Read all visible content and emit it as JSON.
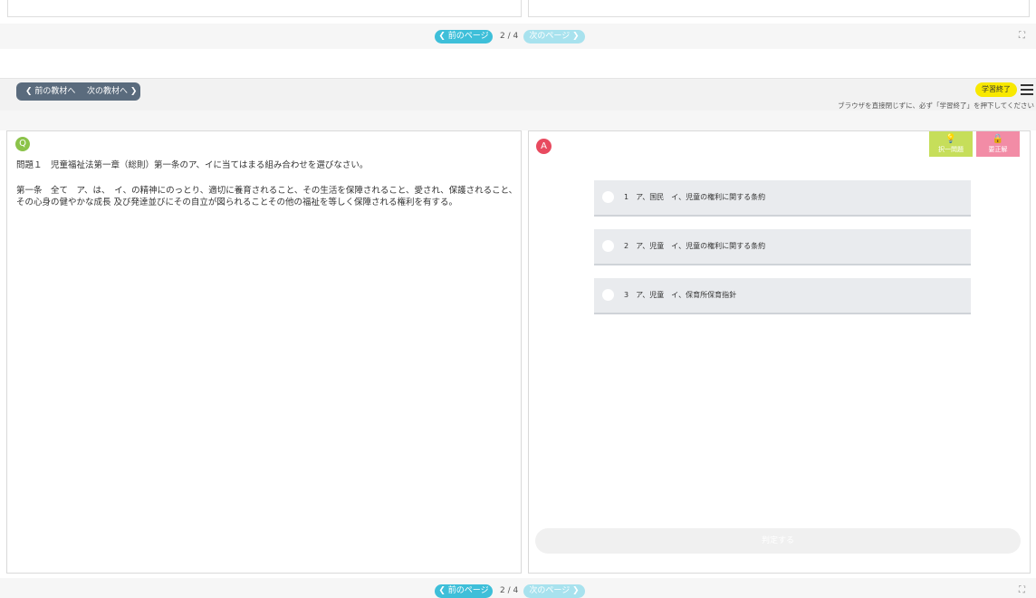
{
  "pager": {
    "prev_label": "❮ 前のページ",
    "page": "2 / 4",
    "next_label": "次のページ ❯",
    "fullscreen_icon": "fullscreen-icon"
  },
  "toolbar": {
    "prev_material": "❮ 前の教材へ",
    "next_material": "次の教材へ ❯",
    "finish_label": "学習終了",
    "notice": "ブラウザを直接閉じずに、必ず「学習終了」を押下してください"
  },
  "question": {
    "badge": "Q",
    "title": "問題１　児童福祉法第一章（総則）第一条のア、イに当てはまる組み合わせを選びなさい。",
    "body": "第一条　全て　ア、は、　イ、の精神にのっとり、適切に養育されること、その生活を保障されること、愛され、保護されること、その心身の健やかな成長 及び発達並びにその自立が図られることその他の福祉を等しく保障される権利を有する。"
  },
  "answer": {
    "badge": "A",
    "hint_label": "択一問題",
    "show_answer_label": "要正解",
    "choices": [
      {
        "label": "1　ア、国民　イ、児童の権利に関する条約"
      },
      {
        "label": "2　ア、児童　イ、児童の権利に関する条約"
      },
      {
        "label": "3　ア、児童　イ、保育所保育指針"
      }
    ],
    "judge_label": "判定する"
  },
  "colors": {
    "accent": "#3ebfd9",
    "finish": "#f8e800",
    "q_badge": "#8bc34a",
    "a_badge": "#e84a5f",
    "hint": "#c6de5a",
    "answer_btn": "#f28ca6"
  }
}
